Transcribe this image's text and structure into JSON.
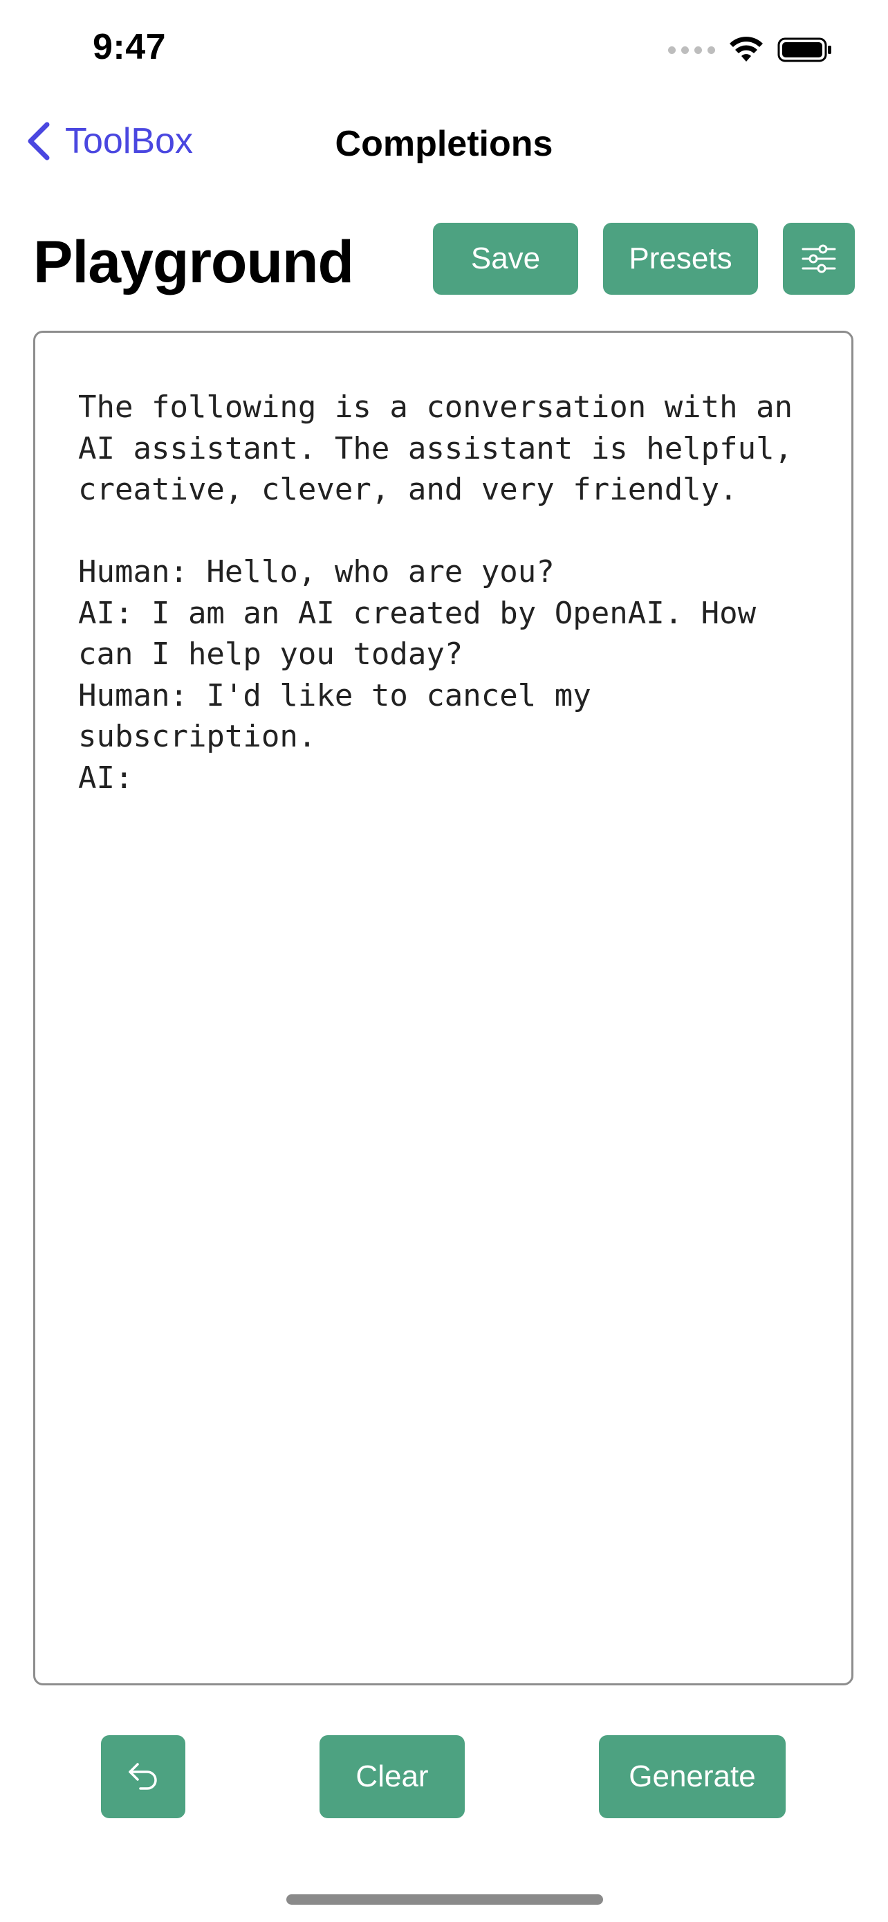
{
  "status_bar": {
    "time": "9:47"
  },
  "nav": {
    "back_label": "ToolBox",
    "title": "Completions"
  },
  "header": {
    "title": "Playground",
    "save_label": "Save",
    "presets_label": "Presets",
    "settings_icon": "sliders-icon"
  },
  "editor": {
    "text": "The following is a conversation with an AI assistant. The assistant is helpful, creative, clever, and very friendly.\n\nHuman: Hello, who are you?\nAI: I am an AI created by OpenAI. How can I help you today?\nHuman: I'd like to cancel my subscription.\nAI:"
  },
  "actions": {
    "undo_icon": "undo-icon",
    "clear_label": "Clear",
    "generate_label": "Generate"
  },
  "colors": {
    "accent": "#4da281",
    "link": "#4a47e0"
  }
}
